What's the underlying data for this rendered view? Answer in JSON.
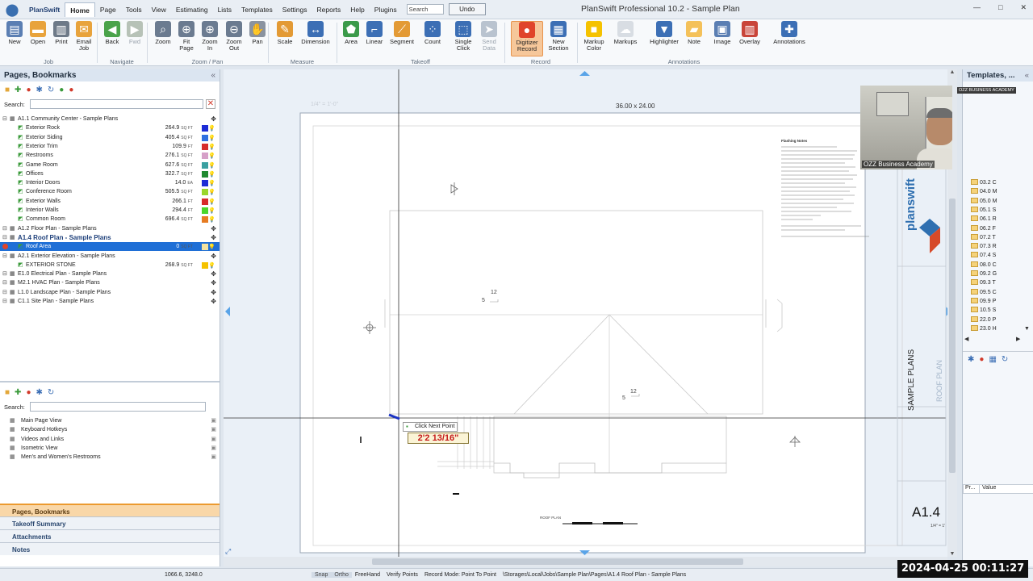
{
  "app": {
    "logo_label": "PlanSwift",
    "title": "PlanSwift Professional 10.2 - Sample Plan",
    "window_buttons": [
      "—",
      "□",
      "✕"
    ]
  },
  "menu": {
    "items": [
      "Home",
      "Page",
      "Tools",
      "View",
      "Estimating",
      "Lists",
      "Templates",
      "Settings",
      "Reports",
      "Help",
      "Plugins"
    ],
    "search_placeholder": "Search",
    "undo_label": "Undo"
  },
  "ribbon": {
    "buttons": [
      {
        "label": "New",
        "icon": "new-icon",
        "color": "#5b7fb3"
      },
      {
        "label": "Open",
        "icon": "open-folder-icon",
        "color": "#e8a33c"
      },
      {
        "label": "Print",
        "icon": "print-icon",
        "color": "#6e7a88"
      },
      {
        "label": "Email\nJob",
        "icon": "email-icon",
        "color": "#e8a33c"
      },
      {
        "label": "Back",
        "icon": "back-arrow-icon",
        "color": "#4aa34a"
      },
      {
        "label": "Fwd",
        "icon": "forward-arrow-icon",
        "color": "#b7c2b7"
      },
      {
        "label": "Zoom",
        "icon": "zoom-icon",
        "color": "#6b7b90"
      },
      {
        "label": "Fit\nPage",
        "icon": "fit-page-icon",
        "color": "#6b7b90"
      },
      {
        "label": "Zoom\nIn",
        "icon": "zoom-in-icon",
        "color": "#6b7b90"
      },
      {
        "label": "Zoom\nOut",
        "icon": "zoom-out-icon",
        "color": "#6b7b90"
      },
      {
        "label": "Pan",
        "icon": "pan-hand-icon",
        "color": "#8a93a0"
      },
      {
        "label": "Scale",
        "icon": "scale-icon",
        "color": "#e39a35"
      },
      {
        "label": "Dimension",
        "icon": "dimension-icon",
        "color": "#3c6fb5"
      },
      {
        "label": "Area",
        "icon": "area-icon",
        "color": "#3b9a4a"
      },
      {
        "label": "Linear",
        "icon": "linear-icon",
        "color": "#3c6fb5"
      },
      {
        "label": "Segment",
        "icon": "segment-icon",
        "color": "#e39a35"
      },
      {
        "label": "Count",
        "icon": "count-icon",
        "color": "#3c6fb5"
      },
      {
        "label": "Single\nClick",
        "icon": "single-click-icon",
        "color": "#3c6fb5"
      },
      {
        "label": "Send\nData",
        "icon": "send-data-icon",
        "color": "#b9c3cf"
      },
      {
        "label": "Digitizer\nRecord",
        "icon": "record-icon",
        "color": "#e0442a"
      },
      {
        "label": "New\nSection",
        "icon": "new-section-icon",
        "color": "#3c6fb5"
      },
      {
        "label": "Markup\nColor",
        "icon": "markup-color-icon",
        "color": "#f5c200"
      },
      {
        "label": "Markups",
        "icon": "markups-icon",
        "color": "#d8dde3"
      },
      {
        "label": "Highlighter",
        "icon": "highlighter-icon",
        "color": "#3c6fb5"
      },
      {
        "label": "Note",
        "icon": "note-icon",
        "color": "#f4c15a"
      },
      {
        "label": "Image",
        "icon": "image-icon",
        "color": "#5b7fb3"
      },
      {
        "label": "Overlay",
        "icon": "overlay-icon",
        "color": "#c9453a"
      },
      {
        "label": "Annotations",
        "icon": "annotations-icon",
        "color": "#3c6fb5"
      }
    ],
    "groups": [
      "Job",
      "Navigate",
      "Zoom / Pan",
      "Measure",
      "Takeoff",
      "Record",
      "Annotations"
    ]
  },
  "pages_panel": {
    "title": "Pages, Bookmarks",
    "search_label": "Search:",
    "rows": [
      {
        "kind": "page",
        "name": "A1.1 Community Center - Sample Plans"
      },
      {
        "kind": "item",
        "name": "Exterior Rock",
        "qty": "264.9",
        "unit": "SQ FT",
        "color": "#1c2bd6"
      },
      {
        "kind": "item",
        "name": "Exterior Siding",
        "qty": "405.4",
        "unit": "SQ FT",
        "color": "#2f6fe0"
      },
      {
        "kind": "item",
        "name": "Exterior Trim",
        "qty": "109.9",
        "unit": "FT",
        "color": "#d62b2b"
      },
      {
        "kind": "item",
        "name": "Restrooms",
        "qty": "276.1",
        "unit": "SQ FT",
        "color": "#d6a0c8"
      },
      {
        "kind": "item",
        "name": "Game Room",
        "qty": "627.6",
        "unit": "SQ FT",
        "color": "#3aa0a0"
      },
      {
        "kind": "item",
        "name": "Offices",
        "qty": "322.7",
        "unit": "SQ FT",
        "color": "#1f8a2f"
      },
      {
        "kind": "item",
        "name": "Interior Doors",
        "qty": "14.0",
        "unit": "EA",
        "color": "#1c2bd6"
      },
      {
        "kind": "item",
        "name": "Conference Room",
        "qty": "505.5",
        "unit": "SQ FT",
        "color": "#9ad62b"
      },
      {
        "kind": "item",
        "name": "Exterior Walls",
        "qty": "266.1",
        "unit": "FT",
        "color": "#d62b2b"
      },
      {
        "kind": "item",
        "name": "Interior Walls",
        "qty": "294.4",
        "unit": "FT",
        "color": "#4ad62b"
      },
      {
        "kind": "item",
        "name": "Common Room",
        "qty": "696.4",
        "unit": "SQ FT",
        "color": "#e67b22"
      },
      {
        "kind": "page",
        "name": "A1.2 Floor Plan - Sample Plans"
      },
      {
        "kind": "page-bold",
        "name": "A1.4 Roof Plan - Sample Plans"
      },
      {
        "kind": "item-sel",
        "name": "Roof Area",
        "qty": "0",
        "unit": "SQ FT",
        "color": "#f2e2a0"
      },
      {
        "kind": "page",
        "name": "A2.1 Exterior Elevation - Sample Plans"
      },
      {
        "kind": "item",
        "name": "EXTERIOR STONE",
        "qty": "268.9",
        "unit": "SQ FT",
        "color": "#f5c200"
      },
      {
        "kind": "page",
        "name": "E1.0 Electrical Plan - Sample Plans"
      },
      {
        "kind": "page",
        "name": "M2.1 HVAC Plan - Sample Plans"
      },
      {
        "kind": "page",
        "name": "L1.0 Landscape Plan - Sample Plans"
      },
      {
        "kind": "page",
        "name": "C1.1 Site Plan - Sample Plans"
      }
    ]
  },
  "bookmarks_panel": {
    "search_label": "Search:",
    "items": [
      "Main Page View",
      "Keyboard Hotkeys",
      "Videos and Links",
      "Isometric View",
      "Men's and Women's Restrooms"
    ]
  },
  "bottom_tabs": [
    "Pages, Bookmarks",
    "Takeoff Summary",
    "Attachments",
    "Notes"
  ],
  "drawing": {
    "sheet_size": "36.00 x 24.00",
    "scale_text": "1/4\" = 1'-0\"",
    "tooltip_label": "Click Next Point",
    "measurement": "2'2 13/16\"",
    "pitch_1_top": "12",
    "pitch_1_left": "5",
    "pitch_2_top": "12",
    "pitch_2_left": "5",
    "sheet_number": "A1.4",
    "title_block_text": "SAMPLE PLANS",
    "title_block_subtext": "ROOF PLAN",
    "brand_text": "planswift",
    "notes_heading": "Flashing Notes",
    "roof_plan_caption": "ROOF PLAN",
    "scale_small": "1/4\" = 1'"
  },
  "templates_panel": {
    "title": "Templates, ...",
    "folders": [
      "03.2 C",
      "04.0 M",
      "05.0 M",
      "05.1 S",
      "06.1 R",
      "06.2 F",
      "07.2 T",
      "07.3 R",
      "07.4 S",
      "08.0 C",
      "09.2 G",
      "09.3 T",
      "09.5 C",
      "09.9 P",
      "10.5 S",
      "22.0 P",
      "23.0 H"
    ],
    "prop_col": "Pr...",
    "value_col": "Value"
  },
  "webcam": {
    "caption": "OZZ Business Academy",
    "badge": "OZZ BUSINESS ACADEMY"
  },
  "status": {
    "coords": "1066.6, 3248.0",
    "cells": [
      "Snap",
      "Ortho",
      "FreeHand",
      "Verify Points",
      "Record Mode: Point To Point",
      "\\Storages\\Local\\Jobs\\Sample Plan\\Pages\\A1.4 Roof Plan - Sample Plans"
    ],
    "timestamp": "2024-04-25  00:11:27"
  }
}
